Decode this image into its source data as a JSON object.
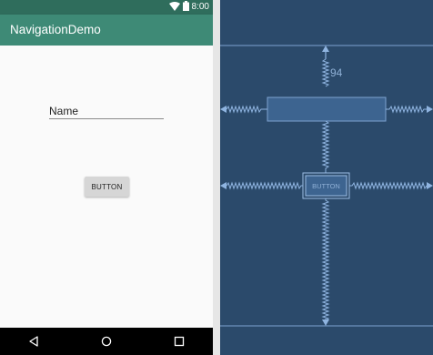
{
  "status_bar": {
    "time": "8:00",
    "icons": [
      "wifi-icon",
      "battery-icon"
    ]
  },
  "app_bar": {
    "title": "NavigationDemo"
  },
  "form": {
    "name_value": "Name",
    "button_label": "BUTTON"
  },
  "nav_bar": {
    "icons": [
      "back-icon",
      "home-icon",
      "recents-icon"
    ]
  },
  "blueprint": {
    "margin_label": "94",
    "button_label": "BUTTON"
  },
  "colors": {
    "status_bar": "#2f6d5c",
    "app_bar": "#3e8a76",
    "blueprint_bg": "#2b4a6b",
    "blueprint_line": "#7ea3d0"
  }
}
